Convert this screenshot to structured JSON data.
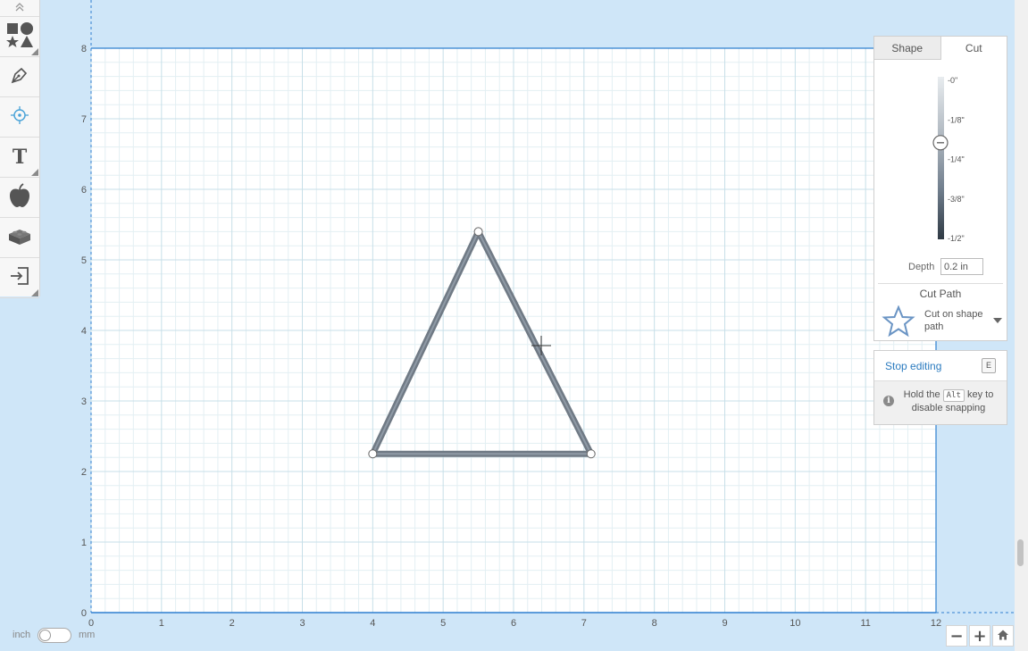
{
  "toolbar": {
    "collapse_icon": "chevrons-up-icon",
    "tools": [
      {
        "name": "shapes-tool",
        "icon": "shapes-icon"
      },
      {
        "name": "pen-tool",
        "icon": "pen-nib-icon"
      },
      {
        "name": "point-tool",
        "icon": "target-icon"
      },
      {
        "name": "text-tool",
        "icon": "text-icon",
        "label": "T"
      },
      {
        "name": "icons-tool",
        "icon": "apple-icon"
      },
      {
        "name": "apps-tool",
        "icon": "lego-brick-icon"
      },
      {
        "name": "import-tool",
        "icon": "import-icon"
      }
    ]
  },
  "canvas": {
    "x_labels": [
      "0",
      "1",
      "2",
      "3",
      "4",
      "5",
      "6",
      "7",
      "8",
      "9",
      "10",
      "11",
      "12"
    ],
    "y_labels": [
      "0",
      "1",
      "2",
      "3",
      "4",
      "5",
      "6",
      "7",
      "8"
    ],
    "colors": {
      "background": "#cfe6f8",
      "grid_major": "#c7dfe8",
      "grid_minor": "#e3eff3",
      "axis": "#2f7fcf",
      "shape": "#707a85"
    },
    "shape": {
      "type": "triangle",
      "vertices_in": [
        [
          5.5,
          5.4
        ],
        [
          4.0,
          2.25
        ],
        [
          7.1,
          2.25
        ]
      ]
    }
  },
  "panel": {
    "tabs": [
      {
        "label": "Shape",
        "active": false
      },
      {
        "label": "Cut",
        "active": true
      }
    ],
    "depth_scale": {
      "ticks": [
        {
          "label": "-0\""
        },
        {
          "label": "-1/8\""
        },
        {
          "label": "-1/4\""
        },
        {
          "label": "-3/8\""
        },
        {
          "label": "-1/2\""
        }
      ],
      "current_depth_in": 0.2
    },
    "depth_label": "Depth",
    "depth_value": "0.2 in",
    "cut_path_title": "Cut Path",
    "cut_path_option": "Cut on shape path",
    "cut_path_icon": "star-icon"
  },
  "edit_panel": {
    "stop_label": "Stop editing",
    "shortcut": "E",
    "hint_before": "Hold the",
    "hint_key": "Alt",
    "hint_after": "key to disable snapping"
  },
  "units": {
    "left": "inch",
    "right": "mm",
    "mode": "inch"
  },
  "zoom": {
    "out": "−",
    "in": "+",
    "home_icon": "home-icon"
  }
}
